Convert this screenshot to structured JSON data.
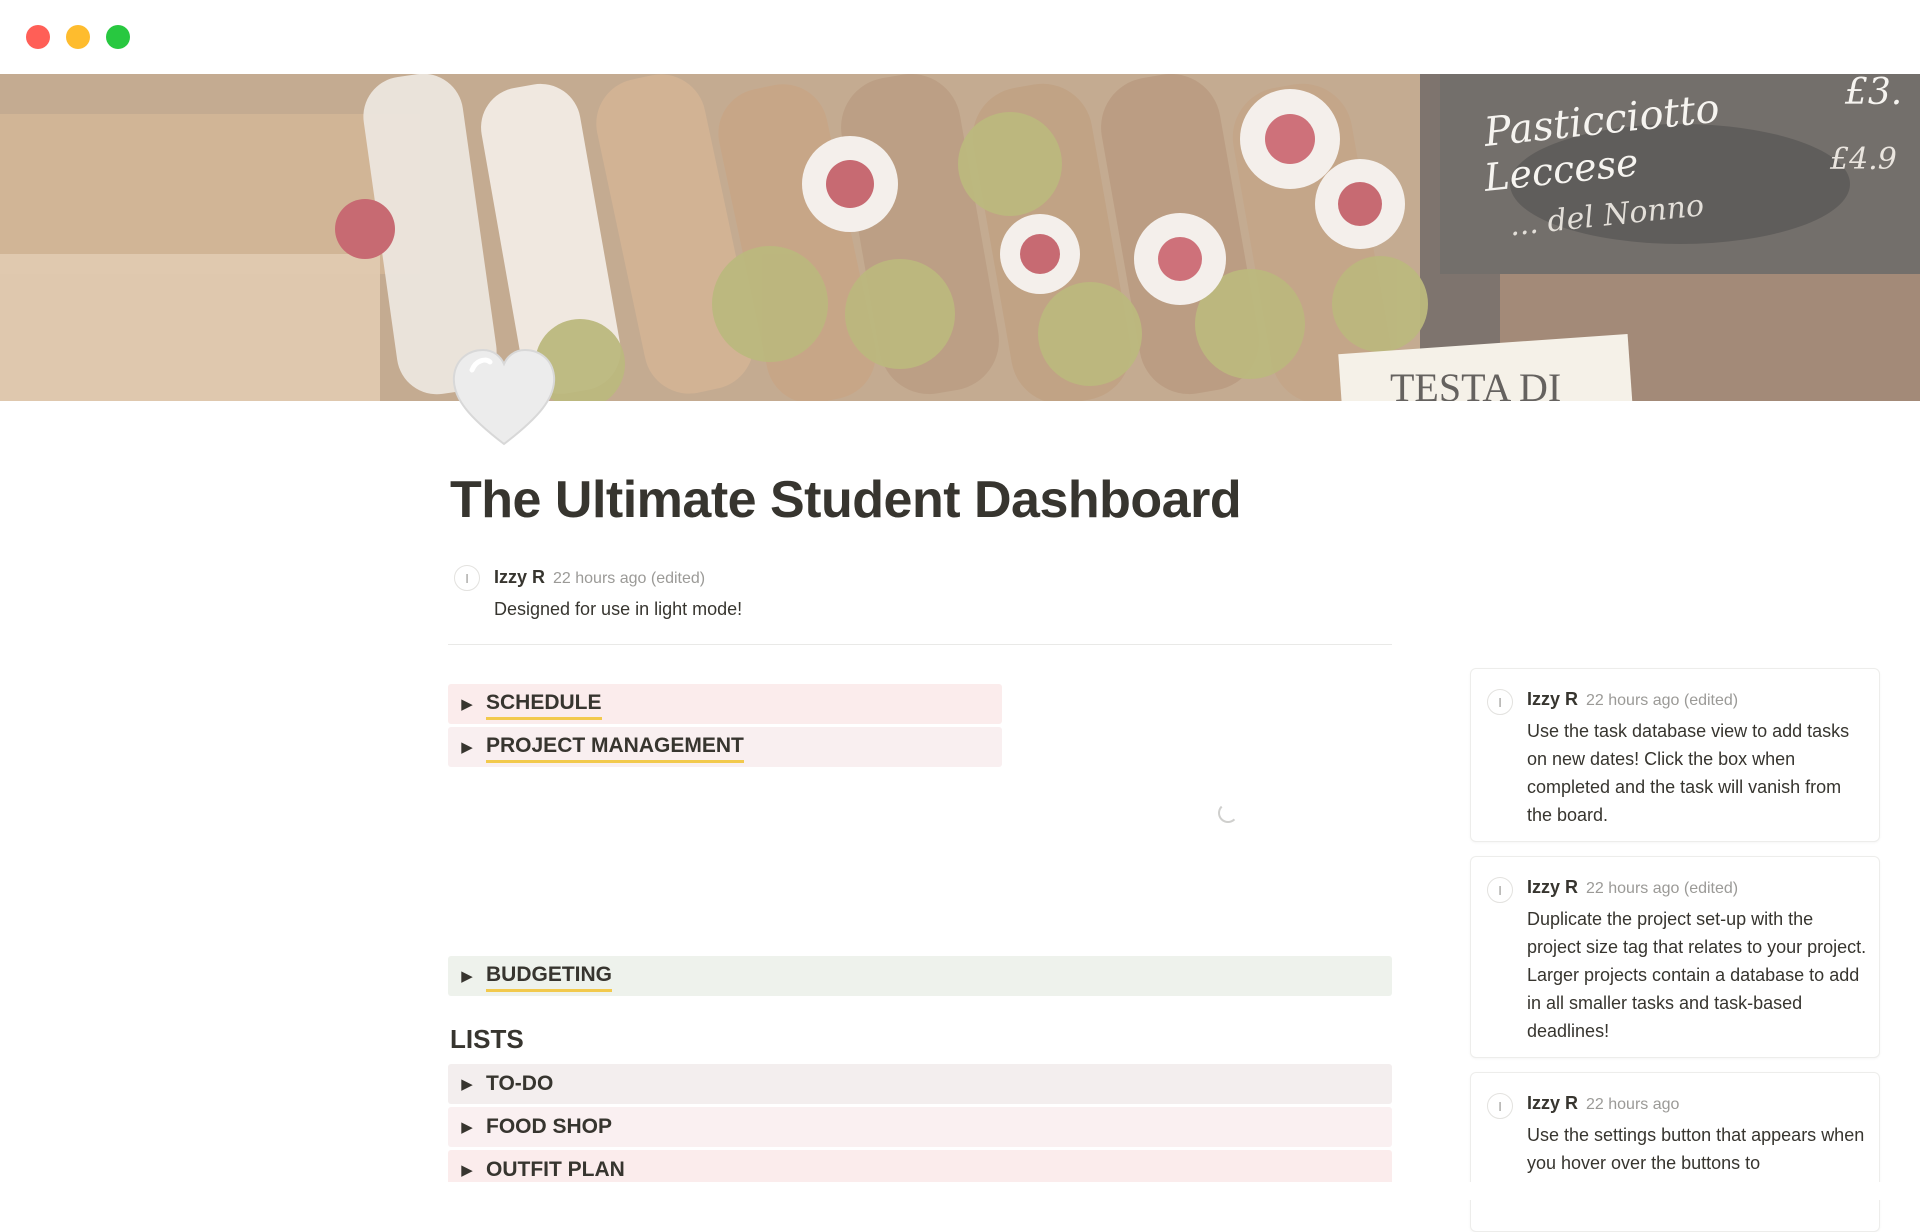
{
  "window": {
    "controls": [
      "close",
      "minimize",
      "zoom"
    ]
  },
  "cover": {
    "image": "cannoli-pastry-photo",
    "sign_text_1": "Pasticciotto",
    "sign_text_2": "Leccese",
    "sign_text_3": "... del Nonno",
    "price_text": "£3.",
    "price_text_2": "£4.9",
    "label_card_text": "TESTA DI"
  },
  "page": {
    "icon": "white-heart-icon",
    "title": "The Ultimate Student Dashboard"
  },
  "top_comment": {
    "avatar_letter": "I",
    "author": "Izzy R",
    "time": "22 hours ago (edited)",
    "body": "Designed for use in light mode!"
  },
  "toggles": {
    "schedule": "SCHEDULE",
    "project_management": "PROJECT MANAGEMENT",
    "budgeting": "BUDGETING",
    "todo": "TO-DO",
    "food_shop": "FOOD SHOP",
    "outfit_plan": "OUTFIT PLAN",
    "arrow": "▶"
  },
  "lists_heading": "LISTS",
  "side_comments": [
    {
      "avatar_letter": "I",
      "author": "Izzy R",
      "time": "22 hours ago (edited)",
      "body": "Use the task database view to add tasks on new dates! Click the box when completed and the task will vanish from the board."
    },
    {
      "avatar_letter": "I",
      "author": "Izzy R",
      "time": "22 hours ago (edited)",
      "body": "Duplicate the project set-up with the project size tag that relates to your project. Larger projects contain a database to add in all smaller tasks and task-based deadlines!"
    },
    {
      "avatar_letter": "I",
      "author": "Izzy R",
      "time": "22 hours ago",
      "body": "Use the settings button that appears when you hover over the buttons to"
    }
  ],
  "colors": {
    "text": "#37352f",
    "muted": "#9b9a97",
    "underline": "#f2c94c",
    "schedule_bg": "#fbecec",
    "budget_bg": "#eef2ec"
  }
}
